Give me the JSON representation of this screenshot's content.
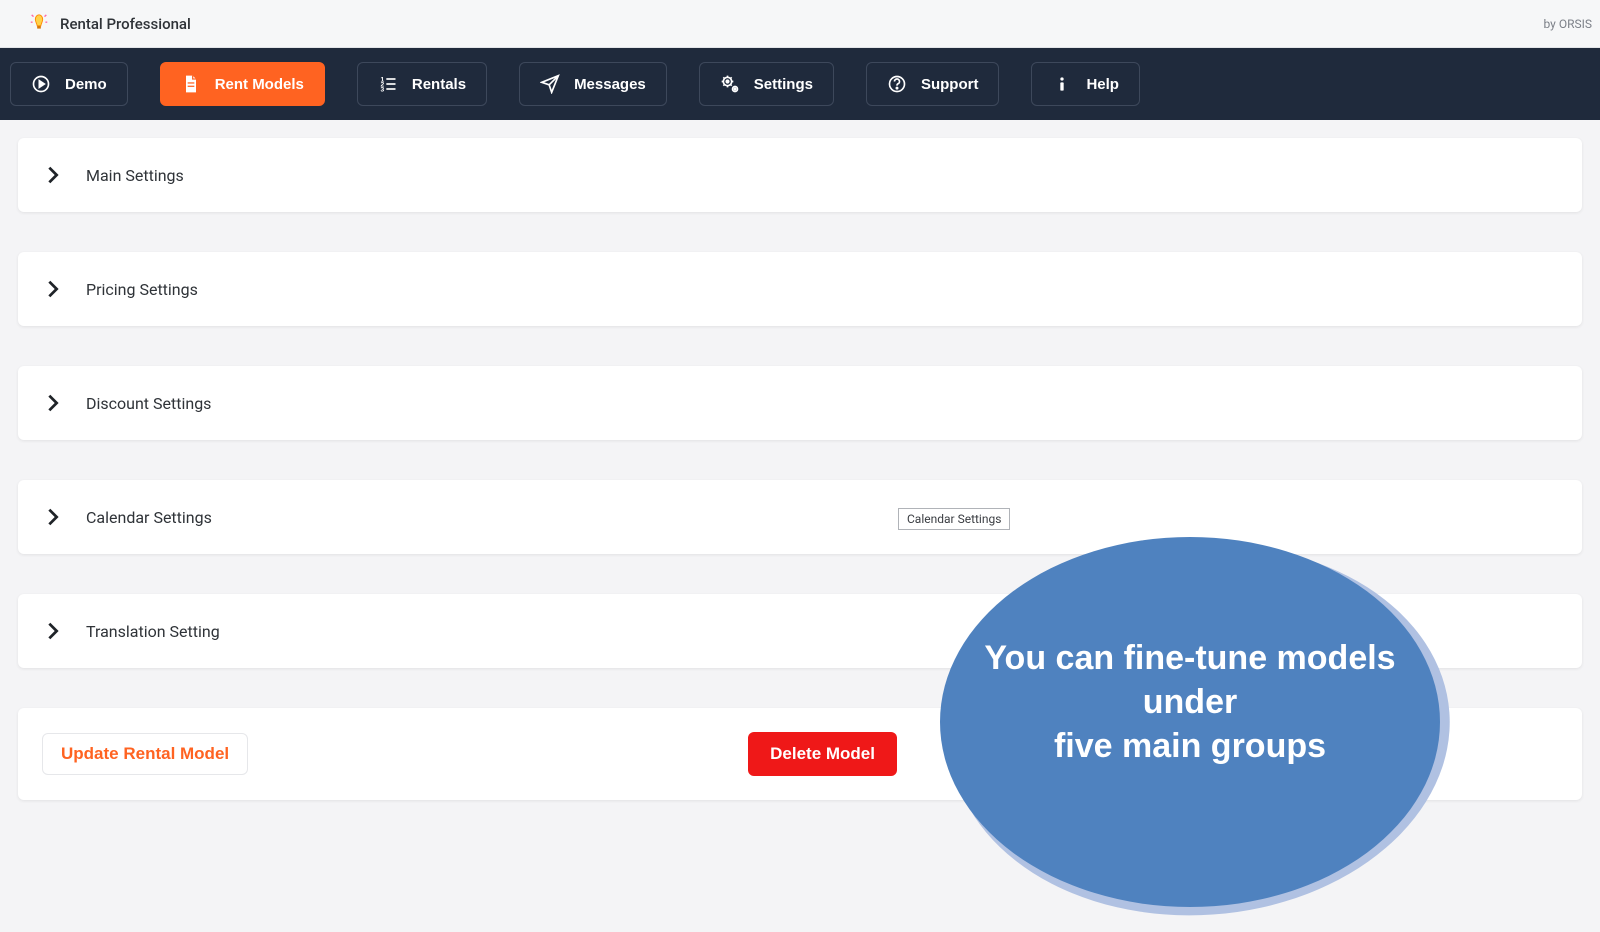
{
  "header": {
    "app_title": "Rental Professional",
    "vendor": "by ORSIS"
  },
  "nav": {
    "items": [
      {
        "label": "Demo",
        "icon": "play-icon",
        "active": false
      },
      {
        "label": "Rent Models",
        "icon": "document-icon",
        "active": true
      },
      {
        "label": "Rentals",
        "icon": "list-icon",
        "active": false
      },
      {
        "label": "Messages",
        "icon": "send-icon",
        "active": false
      },
      {
        "label": "Settings",
        "icon": "gear-icon",
        "active": false
      },
      {
        "label": "Support",
        "icon": "help-circle-icon",
        "active": false
      },
      {
        "label": "Help",
        "icon": "info-icon",
        "active": false
      }
    ]
  },
  "panels": [
    {
      "title": "Main Settings"
    },
    {
      "title": "Pricing Settings"
    },
    {
      "title": "Discount Settings"
    },
    {
      "title": "Calendar Settings"
    },
    {
      "title": "Translation Setting"
    }
  ],
  "tooltip": {
    "text": "Calendar Settings"
  },
  "actions": {
    "update_label": "Update Rental Model",
    "delete_label": "Delete Model"
  },
  "callout": {
    "text": "You can fine-tune models under\nfive main groups"
  }
}
